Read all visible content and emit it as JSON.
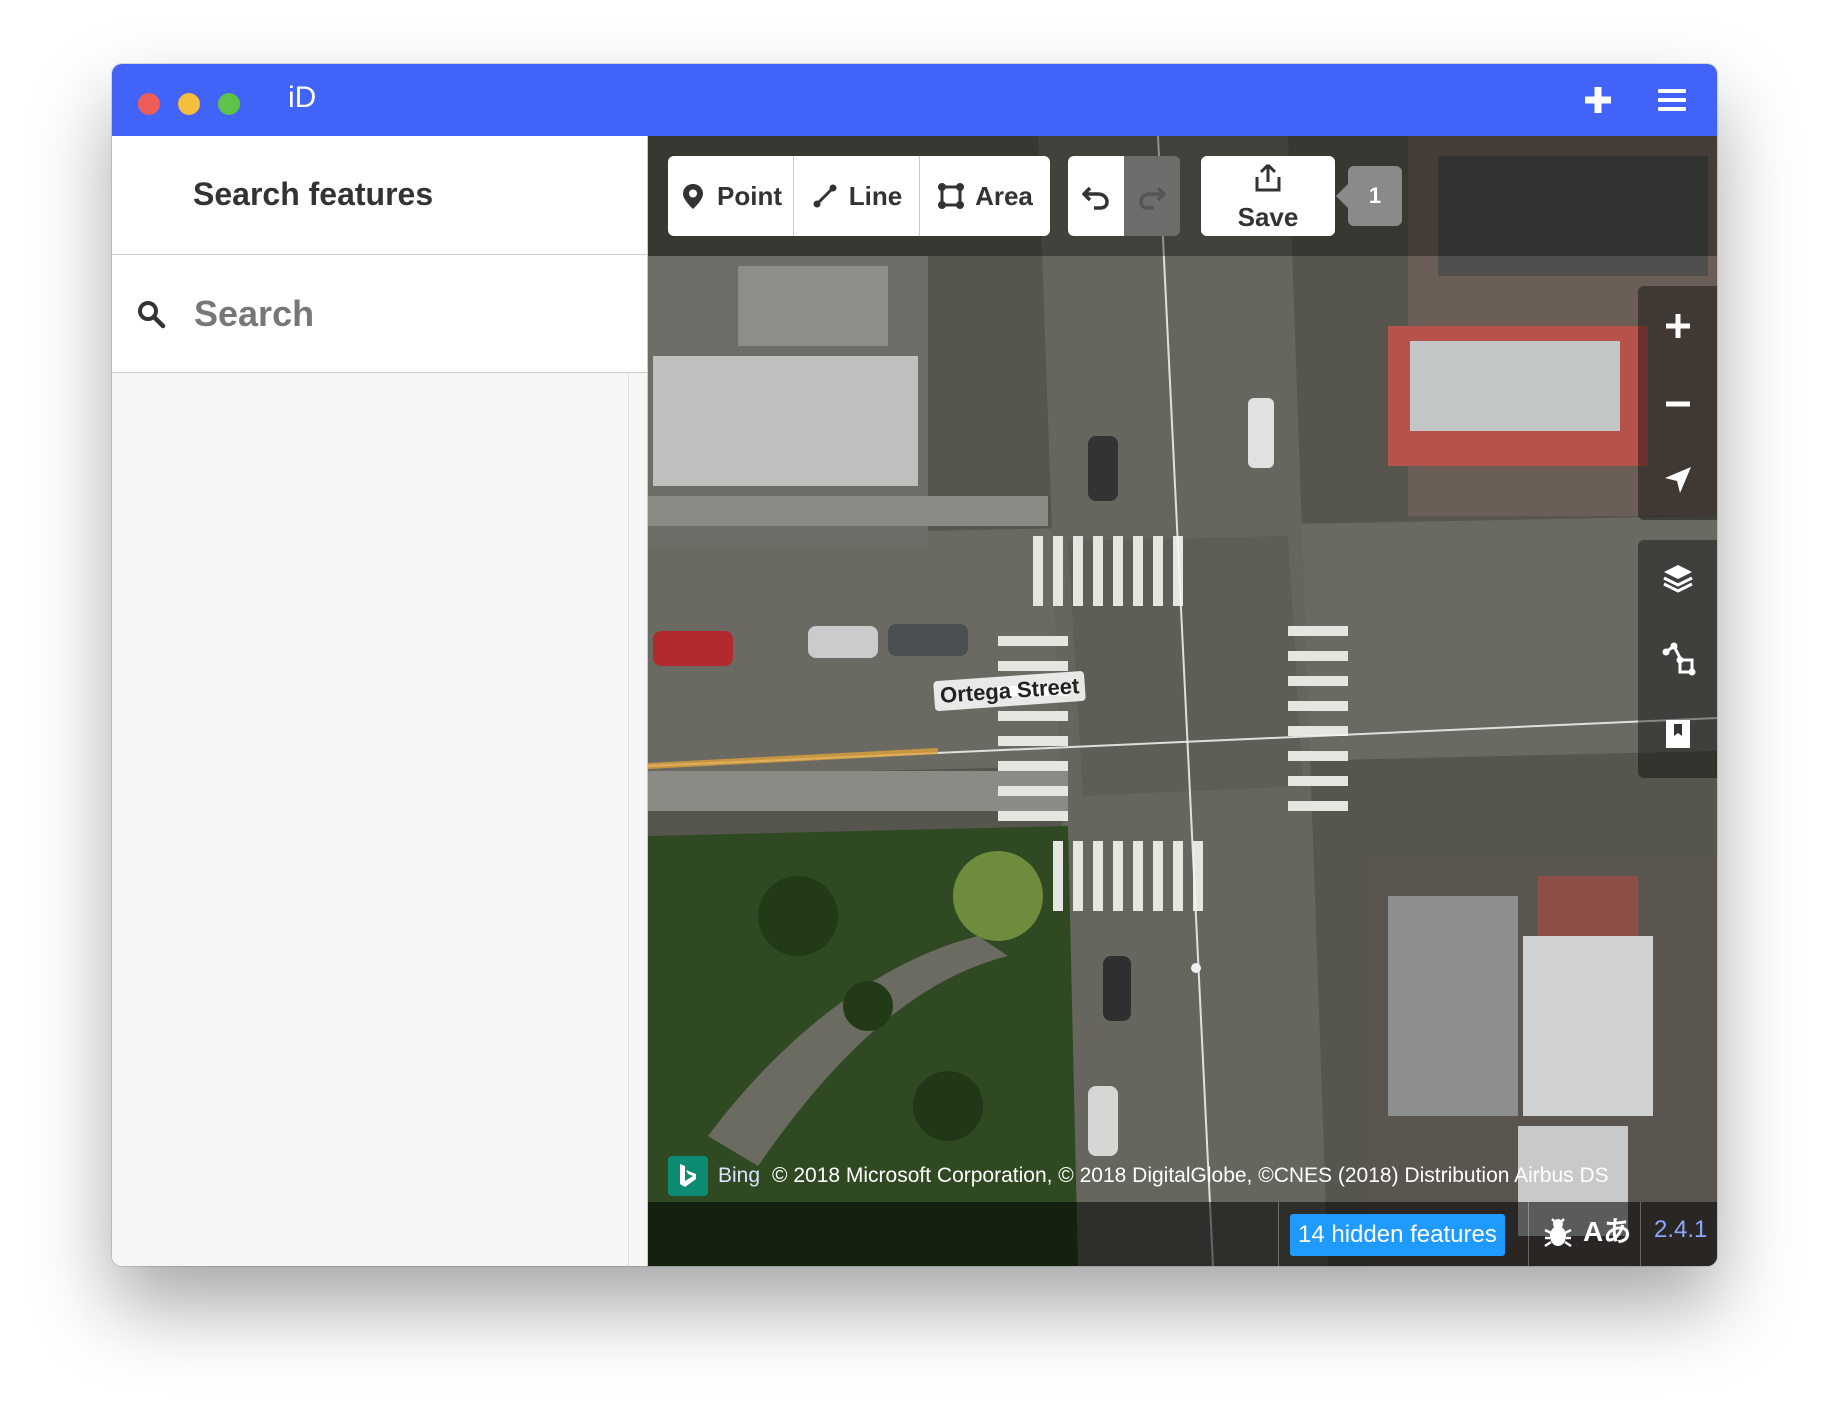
{
  "window": {
    "title": "iD"
  },
  "titlebar": {
    "add_icon": "plus-icon",
    "menu_icon": "hamburger-menu-icon"
  },
  "sidebar": {
    "header": "Search features",
    "search": {
      "placeholder": "Search",
      "value": ""
    }
  },
  "toolbar": {
    "modes": [
      {
        "label": "Point",
        "icon": "map-pin-icon"
      },
      {
        "label": "Line",
        "icon": "line-icon"
      },
      {
        "label": "Area",
        "icon": "area-icon"
      }
    ],
    "undo_icon": "undo-icon",
    "redo_icon": "redo-icon",
    "save_label": "Save",
    "save_icon": "upload-icon",
    "edit_count": "1"
  },
  "map": {
    "street_label": "Ortega Street",
    "controls": [
      "zoom-in-icon",
      "zoom-out-icon",
      "geolocate-icon"
    ],
    "panes": [
      "layers-icon",
      "map-data-icon",
      "help-icon"
    ]
  },
  "attribution": {
    "provider": "Bing",
    "text": "© 2018 Microsoft Corporation, © 2018 DigitalGlobe, ©CNES (2018) Distribution Airbus DS"
  },
  "footer": {
    "hidden_features": "14 hidden features",
    "issues_icon": "bug-icon",
    "language_icon": "translate-icon",
    "language_text": "Aあ",
    "version": "2.4.1"
  },
  "colors": {
    "titlebar": "#4163f7",
    "accent": "#1f9bff",
    "bing": "#0c8a72"
  }
}
